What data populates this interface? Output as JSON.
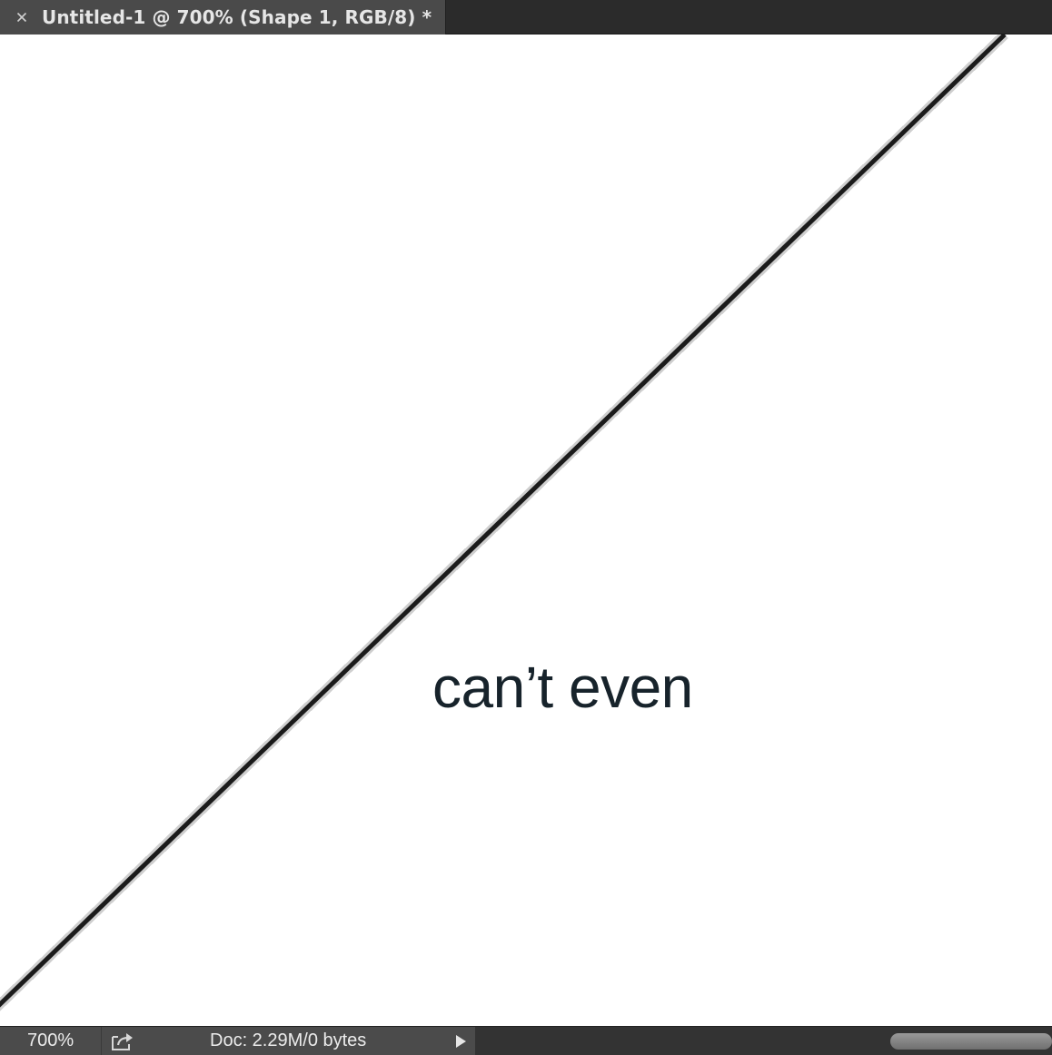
{
  "tab": {
    "title": "Untitled-1 @ 700% (Shape 1, RGB/8) *",
    "close_icon": "close-icon"
  },
  "canvas": {
    "text": "can’t even",
    "text_color": "#17232b",
    "line_color": "#1b1b1b",
    "background": "#ffffff"
  },
  "status": {
    "zoom": "700%",
    "share_icon": "share-export-icon",
    "doc_info": "Doc: 2.29M/0 bytes",
    "menu_icon": "play-triangle-icon"
  }
}
